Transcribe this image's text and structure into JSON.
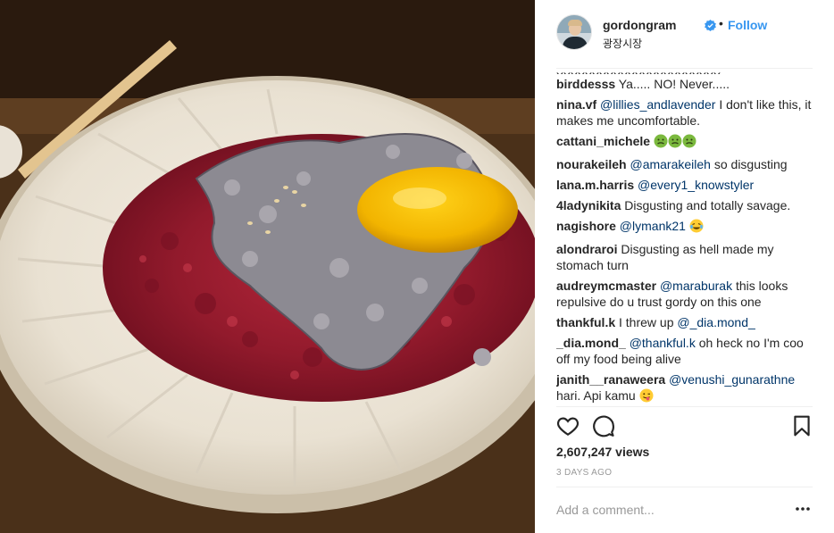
{
  "post": {
    "image_alt": "",
    "username": "gordongram",
    "verified_icon": "verified-badge-icon",
    "separator": "•",
    "follow_label": "Follow",
    "location": "광장시장"
  },
  "comments": [
    {
      "user": "birddesss",
      "mention": "",
      "text": "Ya..... NO! Never.....",
      "emoji": ""
    },
    {
      "user": "nina.vf",
      "mention": "@lillies_andlavender",
      "text": "I don't like this, it makes me uncomfortable.",
      "emoji": ""
    },
    {
      "user": "cattani_michele",
      "mention": "",
      "text": "",
      "emoji": "nauseated-face-x3"
    },
    {
      "user": "nourakeileh",
      "mention": "@amarakeileh",
      "text": "so disgusting",
      "emoji": ""
    },
    {
      "user": "lana.m.harris",
      "mention": "@every1_knowstyler",
      "text": "",
      "emoji": ""
    },
    {
      "user": "4ladynikita",
      "mention": "",
      "text": "Disgusting and totally savage.",
      "emoji": ""
    },
    {
      "user": "nagishore",
      "mention": "@lymank21",
      "text": "",
      "emoji": "tears-of-joy"
    },
    {
      "user": "alondraroi",
      "mention": "",
      "text": "Disgusting as hell made my stomach turn",
      "emoji": ""
    },
    {
      "user": "audreymcmaster",
      "mention": "@maraburak",
      "text": "this looks repulsive do u trust gordy on this one",
      "emoji": ""
    },
    {
      "user": "thankful.k",
      "mention": "",
      "text": "I threw up",
      "mention2": "@_dia.mond_",
      "emoji": ""
    },
    {
      "user": "_dia.mond_",
      "mention": "@thankful.k",
      "text": "oh heck no I'm coo off my food being alive",
      "emoji": ""
    },
    {
      "user": "janith__ranaweera",
      "mention": "@venushi_gunarathne",
      "text": "hari. Api kamu",
      "emoji": "tongue-wink"
    }
  ],
  "actions": {
    "like_icon": "heart-icon",
    "comment_icon": "comment-bubble-icon",
    "save_icon": "bookmark-icon"
  },
  "stats": {
    "views": "2,607,247 views",
    "time_ago": "3 DAYS AGO"
  },
  "composer": {
    "placeholder": "Add a comment...",
    "more_icon": "more-options-icon"
  },
  "colors": {
    "link": "#3897f0",
    "mention": "#003569",
    "muted": "#999999",
    "text": "#262626"
  }
}
